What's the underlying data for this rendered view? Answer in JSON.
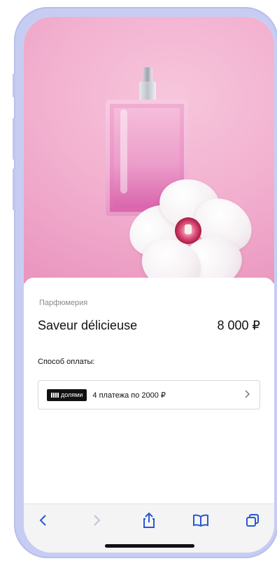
{
  "product": {
    "category": "Парфюмерия",
    "name": "Saveur délicieuse",
    "price": "8 000 ₽"
  },
  "payment": {
    "title": "Способ оплаты:",
    "badge_label": "долями",
    "plan_text": "4 платежа по 2000 ₽"
  },
  "browser_toolbar": {
    "icons": [
      "back-icon",
      "forward-icon",
      "share-icon",
      "bookmarks-icon",
      "tabs-icon"
    ]
  },
  "colors": {
    "accent": "#2a57d6",
    "hero_pink": "#f2b0cf",
    "phone_frame": "#c7cdf2"
  }
}
